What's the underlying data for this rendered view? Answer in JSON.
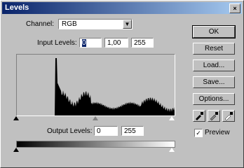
{
  "window": {
    "title": "Levels",
    "close_glyph": "×"
  },
  "channel": {
    "label": "Channel:",
    "value": "RGB"
  },
  "input_levels": {
    "label": "Input Levels:",
    "black": "0",
    "gamma": "1,00",
    "white": "255"
  },
  "output_levels": {
    "label": "Output Levels:",
    "black": "0",
    "white": "255"
  },
  "buttons": {
    "ok": "OK",
    "reset": "Reset",
    "load": "Load...",
    "save": "Save...",
    "options": "Options..."
  },
  "preview": {
    "label": "Preview",
    "checked": true,
    "check_glyph": "✓"
  },
  "icons": {
    "black_eyedropper": "eyedropper-black-icon",
    "gray_eyedropper": "eyedropper-gray-icon",
    "white_eyedropper": "eyedropper-white-icon",
    "dropdown": "chevron-down-icon"
  },
  "histogram": {
    "color": "#000000",
    "peak_level": 64,
    "note": ""
  }
}
